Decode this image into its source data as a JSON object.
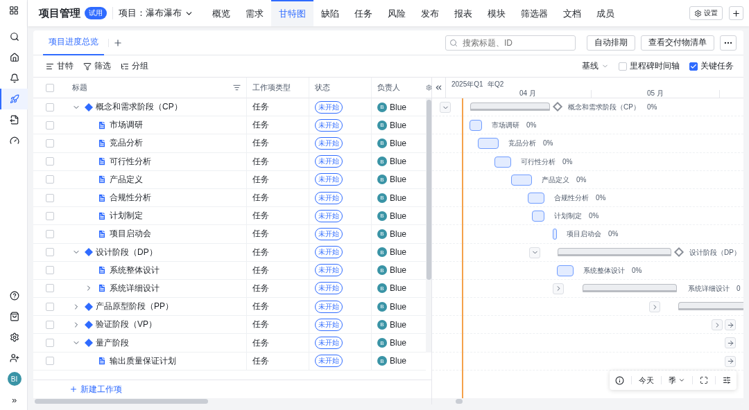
{
  "app": {
    "title": "项目管理",
    "badge": "试用",
    "project": "项目：瀑布瀑布"
  },
  "rail": {
    "top": [
      {
        "kind": "search",
        "selected": false
      },
      {
        "kind": "home",
        "selected": false
      },
      {
        "kind": "bell",
        "selected": false
      },
      {
        "kind": "gantt",
        "selected": true
      },
      {
        "kind": "export",
        "selected": false
      },
      {
        "kind": "gauge",
        "selected": false
      }
    ],
    "bottom": [
      {
        "kind": "help"
      },
      {
        "kind": "bag"
      },
      {
        "kind": "settings"
      },
      {
        "kind": "user-add"
      }
    ],
    "avatar": "BI",
    "expand": "»"
  },
  "nav_tabs": [
    {
      "label": "概览",
      "selected": false
    },
    {
      "label": "需求",
      "selected": false
    },
    {
      "label": "甘特图",
      "selected": true
    },
    {
      "label": "缺陷",
      "selected": false
    },
    {
      "label": "任务",
      "selected": false
    },
    {
      "label": "风险",
      "selected": false
    },
    {
      "label": "发布",
      "selected": false
    },
    {
      "label": "报表",
      "selected": false
    },
    {
      "label": "模块",
      "selected": false
    },
    {
      "label": "筛选器",
      "selected": false
    },
    {
      "label": "文档",
      "selected": false
    },
    {
      "label": "成员",
      "selected": false
    }
  ],
  "header_actions": {
    "settings": "设置"
  },
  "view_tabs": [
    {
      "label": "项目进度总览",
      "selected": true
    }
  ],
  "search": {
    "placeholder": "搜索标题、ID"
  },
  "actions": [
    "自动排期",
    "查看交付物清单"
  ],
  "toolbar": {
    "left": [
      {
        "kind": "gantt",
        "label": "甘特"
      },
      {
        "kind": "filter",
        "label": "筛选"
      },
      {
        "kind": "group",
        "label": "分组"
      }
    ],
    "baseline": "基线",
    "options": [
      {
        "label": "里程碑时间轴",
        "checked": false
      },
      {
        "label": "关键任务",
        "checked": true
      }
    ]
  },
  "table": {
    "columns": [
      "标题",
      "工作项类型",
      "状态",
      "负责人"
    ],
    "select_all": false,
    "rows": [
      {
        "title": "概念和需求阶段（CP）",
        "kind": "phase",
        "expanded": true,
        "checked": false,
        "type": "任务",
        "status": "未开始",
        "owner": "Blue",
        "avatar": "B",
        "children": [
          {
            "title": "市场调研",
            "kind": "task",
            "checked": false,
            "type": "任务",
            "status": "未开始",
            "owner": "Blue",
            "avatar": "B"
          },
          {
            "title": "竞品分析",
            "kind": "task",
            "checked": false,
            "type": "任务",
            "status": "未开始",
            "owner": "Blue",
            "avatar": "B"
          },
          {
            "title": "可行性分析",
            "kind": "task",
            "checked": false,
            "type": "任务",
            "status": "未开始",
            "owner": "Blue",
            "avatar": "B"
          },
          {
            "title": "产品定义",
            "kind": "task",
            "checked": false,
            "type": "任务",
            "status": "未开始",
            "owner": "Blue",
            "avatar": "B"
          },
          {
            "title": "合规性分析",
            "kind": "task",
            "checked": false,
            "type": "任务",
            "status": "未开始",
            "owner": "Blue",
            "avatar": "B"
          },
          {
            "title": "计划制定",
            "kind": "task",
            "checked": false,
            "type": "任务",
            "status": "未开始",
            "owner": "Blue",
            "avatar": "B"
          },
          {
            "title": "项目启动会",
            "kind": "task",
            "checked": false,
            "type": "任务",
            "status": "未开始",
            "owner": "Blue",
            "avatar": "B"
          }
        ]
      },
      {
        "title": "设计阶段（DP）",
        "kind": "phase",
        "expanded": true,
        "checked": false,
        "type": "任务",
        "status": "未开始",
        "owner": "Blue",
        "avatar": "B",
        "children": [
          {
            "title": "系统整体设计",
            "kind": "task",
            "checked": false,
            "type": "任务",
            "status": "未开始",
            "owner": "Blue",
            "avatar": "B"
          },
          {
            "title": "系统详细设计",
            "kind": "task",
            "expanded": false,
            "checked": false,
            "type": "任务",
            "status": "未开始",
            "owner": "Blue",
            "avatar": "B"
          }
        ]
      },
      {
        "title": "产品原型阶段（PP）",
        "kind": "phase",
        "expanded": false,
        "checked": false,
        "type": "任务",
        "status": "未开始",
        "owner": "Blue",
        "avatar": "B"
      },
      {
        "title": "验证阶段（VP）",
        "kind": "phase",
        "expanded": false,
        "checked": false,
        "type": "任务",
        "status": "未开始",
        "owner": "Blue",
        "avatar": "B"
      },
      {
        "title": "量产阶段",
        "kind": "phase",
        "expanded": true,
        "checked": false,
        "type": "任务",
        "status": "未开始",
        "owner": "Blue",
        "avatar": "B",
        "children": [
          {
            "title": "输出质量保证计划",
            "kind": "task",
            "checked": false,
            "type": "任务",
            "status": "未开始",
            "owner": "Blue",
            "avatar": "B"
          }
        ]
      }
    ],
    "new_item": "新建工作项"
  },
  "gantt": {
    "quarters": [
      "2025年Q1",
      "年Q2"
    ],
    "months": [
      "04 月",
      "05 月"
    ],
    "bars": [
      {
        "kind": "summary",
        "expanded": true,
        "label": "概念和需求阶段（CP）",
        "progress": "0%"
      },
      {
        "kind": "task",
        "label": "市场调研",
        "progress": "0%"
      },
      {
        "kind": "task",
        "label": "竞品分析",
        "progress": "0%"
      },
      {
        "kind": "task",
        "label": "可行性分析",
        "progress": "0%"
      },
      {
        "kind": "task",
        "label": "产品定义",
        "progress": "0%"
      },
      {
        "kind": "task",
        "label": "合规性分析",
        "progress": "0%"
      },
      {
        "kind": "task",
        "label": "计划制定",
        "progress": "0%"
      },
      {
        "kind": "task",
        "label": "项目启动会",
        "progress": "0%"
      },
      {
        "kind": "summary",
        "expanded": true,
        "label": "设计阶段（DP）"
      },
      {
        "kind": "task",
        "label": "系统整体设计",
        "progress": "0%"
      },
      {
        "kind": "group",
        "expanded": false,
        "label": "系统详细设计",
        "progress": "0"
      },
      {
        "kind": "group",
        "expanded": false
      },
      {
        "expanded": false,
        "offscreen": true
      },
      {
        "offscreen": true
      },
      {
        "offscreen": true
      }
    ],
    "controls": {
      "today": "今天",
      "scale": "季"
    }
  }
}
